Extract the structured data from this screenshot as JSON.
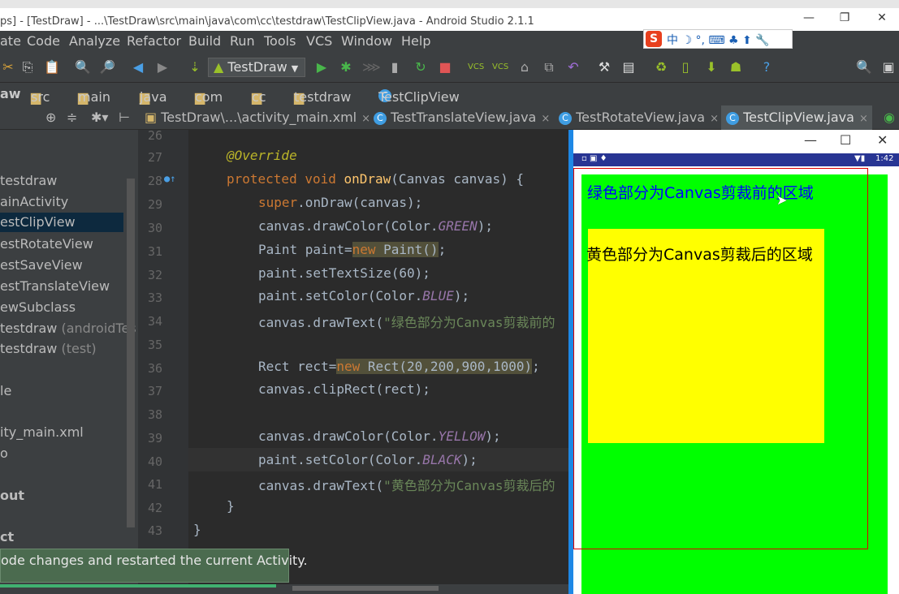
{
  "window": {
    "title": "ps] - [TestDraw] - ...\\TestDraw\\src\\main\\java\\com\\cc\\testdraw\\TestClipView.java - Android Studio 2.1.1"
  },
  "menu": [
    "ate",
    "Code",
    "Analyze",
    "Refactor",
    "Build",
    "Run",
    "Tools",
    "VCS",
    "Window",
    "Help"
  ],
  "ime": {
    "logo": "S",
    "label": "中 ☽ °, ⌨ ♣ ⬆ 🔧"
  },
  "toolbar": {
    "run_config": "TestDraw"
  },
  "breadcrumbs": [
    "aw",
    "src",
    "main",
    "java",
    "com",
    "cc",
    "testdraw",
    "TestClipView"
  ],
  "tabs": [
    {
      "label": "TestDraw\\...\\activity_main.xml",
      "close": "×"
    },
    {
      "label": "TestTranslateView.java",
      "close": "×"
    },
    {
      "label": "TestRotateView.java",
      "close": "×"
    },
    {
      "label": "TestClipView.java",
      "close": "×"
    }
  ],
  "sidebar": {
    "items": [
      "testdraw",
      "ainActivity",
      "estClipView",
      "estRotateView",
      "estSaveView",
      "estTranslateView",
      "ewSubclass",
      "testdraw",
      "testdraw",
      "le",
      "ity_main.xml",
      "o",
      "out",
      "ct"
    ],
    "grey": {
      "androidTest": "(androidTes",
      "test": "(test)"
    }
  },
  "code": {
    "line_numbers": [
      "26",
      "27",
      "28",
      "29",
      "30",
      "31",
      "32",
      "33",
      "34",
      "35",
      "36",
      "37",
      "38",
      "39",
      "40",
      "41",
      "42",
      "43"
    ],
    "override": "@Override",
    "ondraw": {
      "mod": "protected void ",
      "fn": "onDraw",
      "rest": "(Canvas canvas) {"
    },
    "super": {
      "a": "super",
      "b": ".onDraw(canvas);"
    },
    "draw_green": {
      "a": "canvas.drawColor(Color.",
      "b": "GREEN",
      "c": ");"
    },
    "paint": {
      "a": "Paint paint=",
      "b": "new",
      " c": " Paint()",
      "d": ";"
    },
    "text_size": "paint.setTextSize(60);",
    "set_blue": {
      "a": "paint.setColor(Color.",
      "b": "BLUE",
      "c": ");"
    },
    "draw_text1": {
      "a": "canvas.drawText(",
      "b": "\"绿色部分为Canvas剪裁前的"
    },
    "rect": {
      "a": "Rect rect=",
      "b": "new",
      "c": " Rect(20,200,900,1000)",
      "d": ";"
    },
    "clip": "canvas.clipRect(rect);",
    "draw_yellow": {
      "a": "canvas.drawColor(Color.",
      "b": "YELLOW",
      "c": ");"
    },
    "set_black": {
      "a": "paint.setColor(Color.",
      "b": "BLACK",
      "c": ");"
    },
    "draw_text2": {
      "a": "canvas.drawText(",
      "b": "\"黄色部分为Canvas剪裁后的"
    },
    "close_brace": "}",
    "class_brace": "}"
  },
  "emulator": {
    "minimize": "—",
    "maximize": "☐",
    "close": "✕",
    "status_time": "1:42",
    "text_before": "绿色部分为Canvas剪裁前的区域",
    "text_after": "黄色部分为Canvas剪裁后的区域"
  },
  "toast": "ode changes and restarted the current Activity."
}
